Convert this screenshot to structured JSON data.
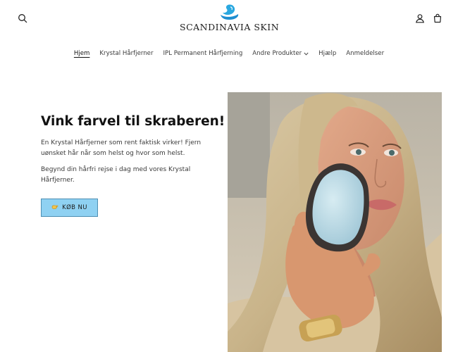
{
  "header": {
    "logo_text": "SCANDINAVIA SKIN",
    "icons": [
      "search-icon",
      "account-icon",
      "cart-icon"
    ]
  },
  "nav": {
    "items": [
      {
        "label": "Hjem",
        "active": true
      },
      {
        "label": "Krystal Hårfjerner"
      },
      {
        "label": "IPL Permanent Hårfjerning"
      },
      {
        "label": "Andre Produkter",
        "has_dropdown": true
      },
      {
        "label": "Hjælp"
      },
      {
        "label": "Anmeldelser"
      }
    ]
  },
  "hero": {
    "title": "Vink farvel til skraberen!",
    "title_emoji": "👋",
    "paragraph1": "En Krystal Hårfjerner som rent faktisk virker! Fjern uønsket hår når som helst og hvor som helst.",
    "paragraph2": "Begynd din hårfri rejse i dag med vores Krystal Hårfjerner.",
    "cta_label": "KØB NU",
    "cta_icon": "hand-icon"
  },
  "colors": {
    "cta_background": "#8fd1f2",
    "logo_blue": "#2aa8e0"
  }
}
